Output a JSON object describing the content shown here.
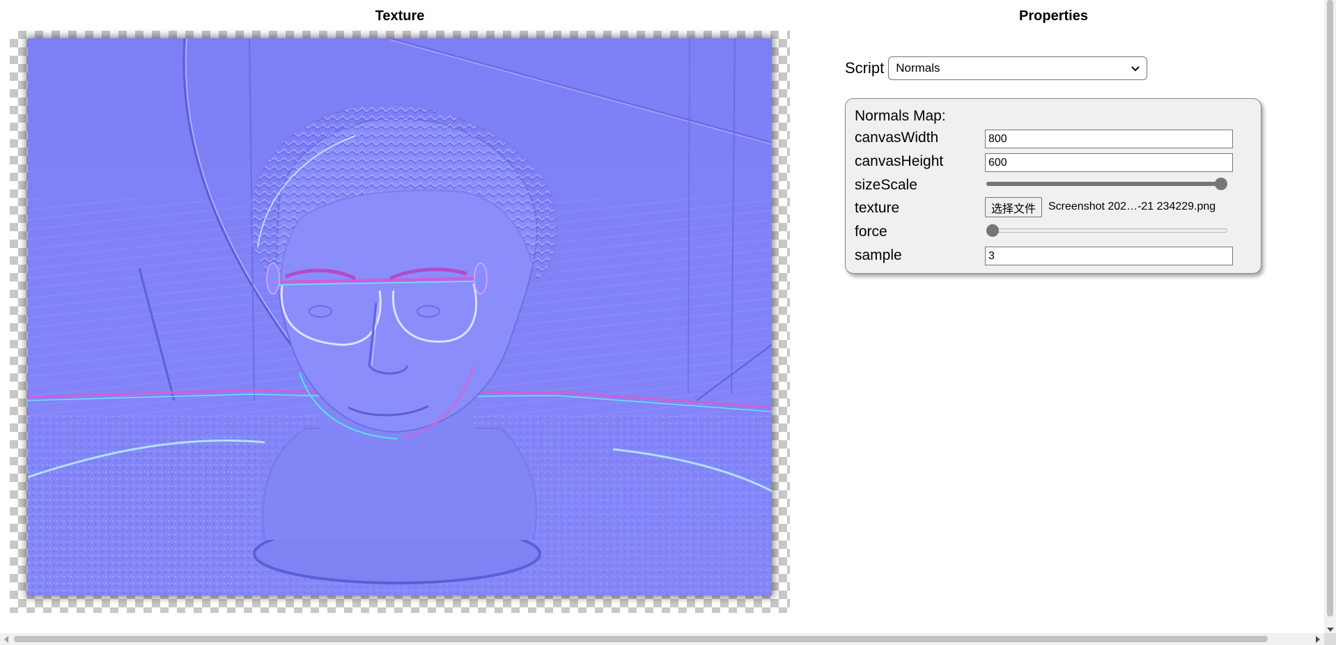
{
  "texture_panel": {
    "title": "Texture"
  },
  "properties_panel": {
    "title": "Properties",
    "script_label": "Script",
    "script_selected": "Normals"
  },
  "normals_map": {
    "heading": "Normals Map:",
    "canvasWidth": {
      "label": "canvasWidth",
      "value": "800"
    },
    "canvasHeight": {
      "label": "canvasHeight",
      "value": "600"
    },
    "sizeScale": {
      "label": "sizeScale",
      "level": 1.0
    },
    "texture": {
      "label": "texture",
      "button_label": "选择文件",
      "file_name": "Screenshot 202…-21 234229.png"
    },
    "force": {
      "label": "force",
      "level": 0.0
    },
    "sample": {
      "label": "sample",
      "value": "3"
    }
  },
  "icons": {
    "select_arrow": "chevron-down-icon",
    "scroll_down": "arrow-down-icon",
    "scroll_left": "arrow-left-icon",
    "scroll_right": "arrow-right-icon"
  },
  "colors": {
    "normal_map_base": "#8080ff",
    "panel_bg": "#f0f0f0",
    "slider_fill": "#767676"
  }
}
